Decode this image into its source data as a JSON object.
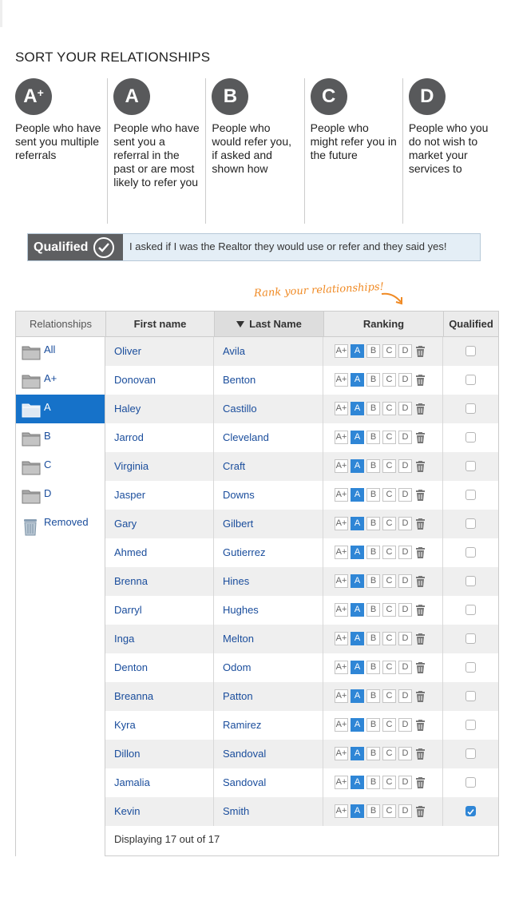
{
  "page_title": "SORT YOUR RELATIONSHIPS",
  "grades": [
    {
      "letter": "A",
      "sup": "+",
      "description": "People who have sent you multiple referrals"
    },
    {
      "letter": "A",
      "sup": "",
      "description": "People who have sent you a referral in the past or are most likely to refer you"
    },
    {
      "letter": "B",
      "sup": "",
      "description": "People who would refer you, if asked and shown how"
    },
    {
      "letter": "C",
      "sup": "",
      "description": "People who might refer you in the future"
    },
    {
      "letter": "D",
      "sup": "",
      "description": "People who you do not wish to market your services to"
    }
  ],
  "qualified": {
    "label": "Qualified",
    "text": "I asked if I was the Realtor they would use or refer and they said yes!"
  },
  "rank_hint": "Rank your relationships!",
  "table": {
    "headers": {
      "relationships": "Relationships",
      "first_name": "First name",
      "last_name": "Last Name",
      "ranking": "Ranking",
      "qualified": "Qualified"
    },
    "sort_column": "last_name",
    "folders": [
      {
        "label": "All",
        "icon": "folder-icon",
        "active": false
      },
      {
        "label": "A+",
        "icon": "folder-icon",
        "active": false
      },
      {
        "label": "A",
        "icon": "folder-icon",
        "active": true
      },
      {
        "label": "B",
        "icon": "folder-icon",
        "active": false
      },
      {
        "label": "C",
        "icon": "folder-icon",
        "active": false
      },
      {
        "label": "D",
        "icon": "folder-icon",
        "active": false
      },
      {
        "label": "Removed",
        "icon": "trash-icon",
        "active": false
      }
    ],
    "ranking_options": [
      "A+",
      "A",
      "B",
      "C",
      "D"
    ],
    "rows": [
      {
        "first": "Oliver",
        "last": "Avila",
        "rank": "A",
        "qualified": false
      },
      {
        "first": "Donovan",
        "last": "Benton",
        "rank": "A",
        "qualified": false
      },
      {
        "first": "Haley",
        "last": "Castillo",
        "rank": "A",
        "qualified": false
      },
      {
        "first": "Jarrod",
        "last": "Cleveland",
        "rank": "A",
        "qualified": false
      },
      {
        "first": "Virginia",
        "last": "Craft",
        "rank": "A",
        "qualified": false
      },
      {
        "first": "Jasper",
        "last": "Downs",
        "rank": "A",
        "qualified": false
      },
      {
        "first": "Gary",
        "last": "Gilbert",
        "rank": "A",
        "qualified": false
      },
      {
        "first": "Ahmed",
        "last": "Gutierrez",
        "rank": "A",
        "qualified": false
      },
      {
        "first": "Brenna",
        "last": "Hines",
        "rank": "A",
        "qualified": false
      },
      {
        "first": "Darryl",
        "last": "Hughes",
        "rank": "A",
        "qualified": false
      },
      {
        "first": "Inga",
        "last": "Melton",
        "rank": "A",
        "qualified": false
      },
      {
        "first": "Denton",
        "last": "Odom",
        "rank": "A",
        "qualified": false
      },
      {
        "first": "Breanna",
        "last": "Patton",
        "rank": "A",
        "qualified": false
      },
      {
        "first": "Kyra",
        "last": "Ramirez",
        "rank": "A",
        "qualified": false
      },
      {
        "first": "Dillon",
        "last": "Sandoval",
        "rank": "A",
        "qualified": false
      },
      {
        "first": "Jamalia",
        "last": "Sandoval",
        "rank": "A",
        "qualified": false
      },
      {
        "first": "Kevin",
        "last": "Smith",
        "rank": "A",
        "qualified": true
      }
    ],
    "footer": "Displaying 17 out of 17"
  },
  "colors": {
    "accent": "#2f86d6",
    "active_folder": "#1672c9",
    "badge": "#58595b",
    "hint": "#f08a24",
    "link": "#1a4d9c"
  }
}
